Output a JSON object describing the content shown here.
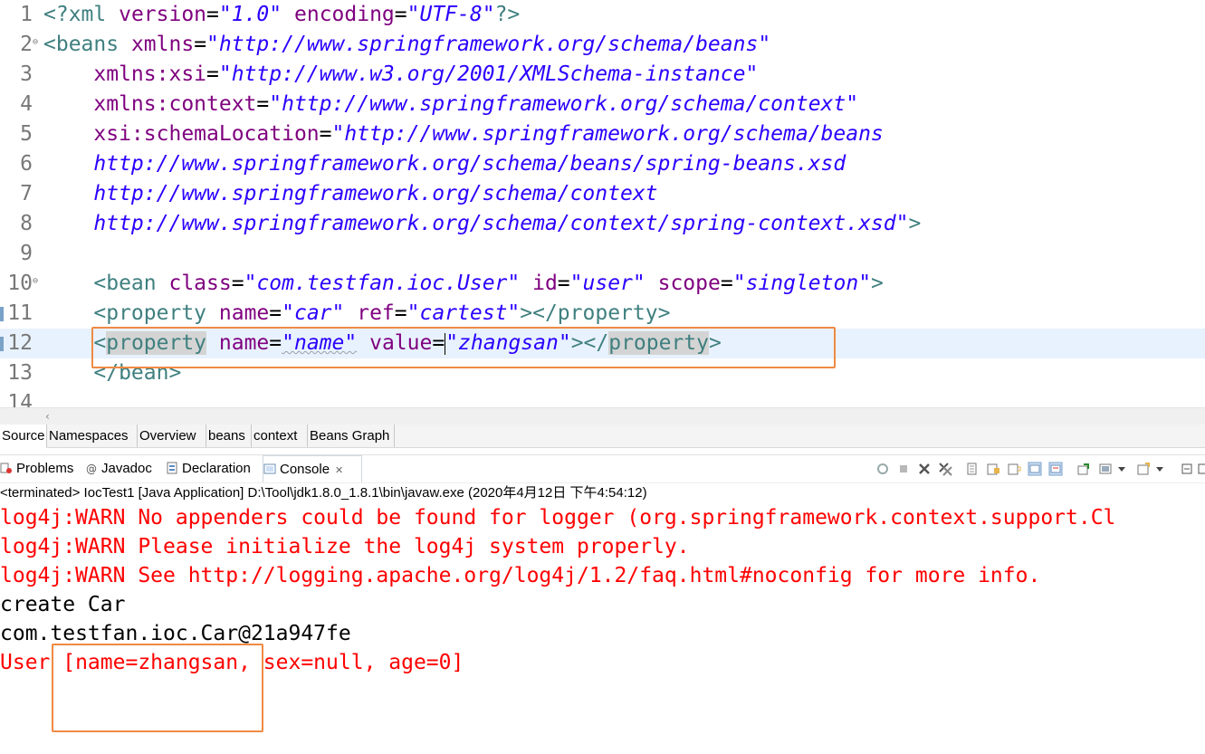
{
  "editor": {
    "lines": [
      {
        "num": "1",
        "parts": [
          [
            "tag",
            "<?xml "
          ],
          [
            "attr",
            "version"
          ],
          [
            "plain",
            "="
          ],
          [
            "val",
            "\"1.0\""
          ],
          [
            "plain",
            " "
          ],
          [
            "attr",
            "encoding"
          ],
          [
            "plain",
            "="
          ],
          [
            "val",
            "\"UTF-8\""
          ],
          [
            "tag",
            "?>"
          ]
        ]
      },
      {
        "num": "2",
        "fold": true,
        "parts": [
          [
            "tag",
            "<beans "
          ],
          [
            "attr",
            "xmlns"
          ],
          [
            "plain",
            "="
          ],
          [
            "val",
            "\"http://www.springframework.org/schema/beans\""
          ]
        ]
      },
      {
        "num": "3",
        "parts": [
          [
            "plain",
            "    "
          ],
          [
            "attr",
            "xmlns:xsi"
          ],
          [
            "plain",
            "="
          ],
          [
            "val",
            "\"http://www.w3.org/2001/XMLSchema-instance\""
          ]
        ]
      },
      {
        "num": "4",
        "parts": [
          [
            "plain",
            "    "
          ],
          [
            "attr",
            "xmlns:context"
          ],
          [
            "plain",
            "="
          ],
          [
            "val",
            "\"http://www.springframework.org/schema/context\""
          ]
        ]
      },
      {
        "num": "5",
        "parts": [
          [
            "plain",
            "    "
          ],
          [
            "attr",
            "xsi:schemaLocation"
          ],
          [
            "plain",
            "="
          ],
          [
            "val",
            "\"http://www.springframework.org/schema/beans"
          ]
        ]
      },
      {
        "num": "6",
        "parts": [
          [
            "plain",
            "    "
          ],
          [
            "val",
            "http://www.springframework.org/schema/beans/spring-beans.xsd"
          ]
        ]
      },
      {
        "num": "7",
        "parts": [
          [
            "plain",
            "    "
          ],
          [
            "val",
            "http://www.springframework.org/schema/context"
          ]
        ]
      },
      {
        "num": "8",
        "parts": [
          [
            "plain",
            "    "
          ],
          [
            "val",
            "http://www.springframework.org/schema/context/spring-context.xsd\""
          ],
          [
            "tag",
            ">"
          ]
        ]
      },
      {
        "num": "9",
        "parts": []
      },
      {
        "num": "10",
        "fold": true,
        "parts": [
          [
            "plain",
            "    "
          ],
          [
            "tag",
            "<bean "
          ],
          [
            "attr",
            "class"
          ],
          [
            "plain",
            "="
          ],
          [
            "val",
            "\"com.testfan.ioc.User\""
          ],
          [
            "plain",
            " "
          ],
          [
            "attr",
            "id"
          ],
          [
            "plain",
            "="
          ],
          [
            "val",
            "\"user\""
          ],
          [
            "plain",
            " "
          ],
          [
            "attr",
            "scope"
          ],
          [
            "plain",
            "="
          ],
          [
            "val",
            "\"singleton\""
          ],
          [
            "tag",
            ">"
          ]
        ]
      },
      {
        "num": "11",
        "parts": [
          [
            "plain",
            "    "
          ],
          [
            "tag",
            "<property "
          ],
          [
            "attr",
            "name"
          ],
          [
            "plain",
            "="
          ],
          [
            "val",
            "\"car\""
          ],
          [
            "plain",
            " "
          ],
          [
            "attr",
            "ref"
          ],
          [
            "plain",
            "="
          ],
          [
            "val",
            "\"cartest\""
          ],
          [
            "tag",
            "></property>"
          ]
        ]
      },
      {
        "num": "12",
        "current": true,
        "parts": [
          [
            "plain",
            "    "
          ],
          [
            "tag",
            "<"
          ],
          [
            "taghl",
            "property"
          ],
          [
            "plain",
            " "
          ],
          [
            "attr",
            "name"
          ],
          [
            "plain",
            "="
          ],
          [
            "valsq",
            "\"name\""
          ],
          [
            "plain",
            " "
          ],
          [
            "attr",
            "value"
          ],
          [
            "plain",
            "="
          ],
          [
            "caret",
            ""
          ],
          [
            "val",
            "\"zhangsan\""
          ],
          [
            "tag",
            "></"
          ],
          [
            "taghl",
            "property"
          ],
          [
            "tag",
            ">"
          ]
        ]
      },
      {
        "num": "13",
        "parts": [
          [
            "plain",
            "    "
          ],
          [
            "tag",
            "</bean>"
          ]
        ]
      },
      {
        "num": "14",
        "parts": []
      }
    ]
  },
  "editor_tabs": [
    "Source",
    "Namespaces",
    "Overview",
    "beans",
    "context",
    "Beans Graph"
  ],
  "views": {
    "tabs": [
      {
        "label": "Problems",
        "icon": "problems-icon"
      },
      {
        "label": "Javadoc",
        "icon": "javadoc-icon"
      },
      {
        "label": "Declaration",
        "icon": "declaration-icon"
      },
      {
        "label": "Console",
        "icon": "console-icon",
        "active": true,
        "close": "✕"
      }
    ]
  },
  "console": {
    "header": "<terminated> IocTest1 [Java Application] D:\\Tool\\jdk1.8.0_1.8.1\\bin\\javaw.exe (2020年4月12日 下午4:54:12)",
    "lines": [
      {
        "kind": "err",
        "text": "log4j:WARN No appenders could be found for logger (org.springframework.context.support.Cl"
      },
      {
        "kind": "err",
        "text": "log4j:WARN Please initialize the log4j system properly."
      },
      {
        "kind": "err",
        "text": "log4j:WARN See http://logging.apache.org/log4j/1.2/faq.html#noconfig for more info."
      },
      {
        "kind": "out",
        "text": "create Car"
      },
      {
        "kind": "out",
        "text": "com.testfan.ioc.Car@21a947fe"
      },
      {
        "kind": "err",
        "text": "User [name=zhangsan, sex=null, age=0]"
      }
    ]
  },
  "colors": {
    "annotation": "#f08a44",
    "error": "#ff0000",
    "tag": "#3f7f7f",
    "attr": "#7f007f",
    "value": "#2a00ff"
  }
}
